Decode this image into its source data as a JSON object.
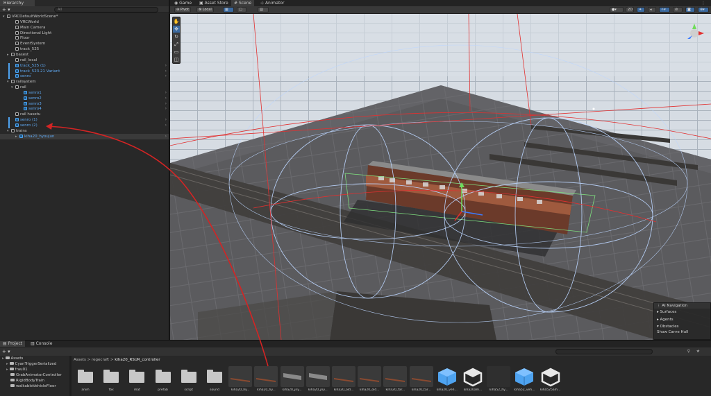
{
  "hierarchy": {
    "tab_label": "Hierarchy",
    "add_label": "+ ▾",
    "search_placeholder": "All",
    "rows": [
      {
        "label": "VRCDefaultWorldScene*",
        "indent": 0,
        "arrow": "▾",
        "blue": false,
        "chev": false
      },
      {
        "label": "VRCWorld",
        "indent": 2,
        "arrow": "",
        "blue": false,
        "chev": false
      },
      {
        "label": "Main Camera",
        "indent": 2,
        "arrow": "",
        "blue": false,
        "chev": false
      },
      {
        "label": "Directional Light",
        "indent": 2,
        "arrow": "",
        "blue": false,
        "chev": false
      },
      {
        "label": "Floor",
        "indent": 2,
        "arrow": "",
        "blue": false,
        "chev": false
      },
      {
        "label": "EventSystem",
        "indent": 2,
        "arrow": "",
        "blue": false,
        "chev": false
      },
      {
        "label": "track_525",
        "indent": 2,
        "arrow": "",
        "blue": false,
        "chev": false
      },
      {
        "label": "basest",
        "indent": 1,
        "arrow": "▸",
        "blue": false,
        "chev": false
      },
      {
        "label": "rail_local",
        "indent": 2,
        "arrow": "",
        "blue": false,
        "chev": false
      },
      {
        "label": "track_525 (1)",
        "indent": 2,
        "arrow": "",
        "blue": true,
        "chev": true
      },
      {
        "label": "track_523.21 Variant",
        "indent": 2,
        "arrow": "",
        "blue": true,
        "chev": true
      },
      {
        "label": "senro",
        "indent": 2,
        "arrow": "",
        "blue": true,
        "chev": true
      },
      {
        "label": "railsystem",
        "indent": 1,
        "arrow": "▾",
        "blue": false,
        "chev": false
      },
      {
        "label": "rail",
        "indent": 2,
        "arrow": "▾",
        "blue": false,
        "chev": false
      },
      {
        "label": "senro1",
        "indent": 4,
        "arrow": "",
        "blue": true,
        "chev": true
      },
      {
        "label": "senro2",
        "indent": 4,
        "arrow": "",
        "blue": true,
        "chev": true
      },
      {
        "label": "senro3",
        "indent": 4,
        "arrow": "",
        "blue": true,
        "chev": true
      },
      {
        "label": "senro4",
        "indent": 4,
        "arrow": "",
        "blue": true,
        "chev": true
      },
      {
        "label": "rail husetu",
        "indent": 2,
        "arrow": "",
        "blue": false,
        "chev": false
      },
      {
        "label": "senro (1)",
        "indent": 2,
        "arrow": "",
        "blue": true,
        "chev": true
      },
      {
        "label": "senro (2)",
        "indent": 2,
        "arrow": "",
        "blue": true,
        "chev": true
      },
      {
        "label": "trains",
        "indent": 1,
        "arrow": "▾",
        "blue": false,
        "chev": false
      },
      {
        "label": "kiha20_hyoujun",
        "indent": 3,
        "arrow": "▸",
        "blue": true,
        "chev": true
      }
    ]
  },
  "scene": {
    "tabs": [
      "Game",
      "Asset Store",
      "Scene",
      "Animator"
    ],
    "active_tab": "Scene",
    "pivot_label": "Pivot",
    "local_label": "Local",
    "mode_2d": "2D"
  },
  "nav_overlay": {
    "title": "AI Navigation",
    "items": [
      "Surfaces",
      "Agents",
      "Obstacles",
      "Show Carve Hull"
    ]
  },
  "project": {
    "tabs": [
      "Project",
      "Console"
    ],
    "add_label": "+ ▾",
    "tree": [
      {
        "label": "Assets",
        "level": 0
      },
      {
        "label": "CyanTriggerSerialized",
        "level": 1
      },
      {
        "label": "frau01",
        "level": 1
      },
      {
        "label": "GrabAnimatorController",
        "level": 2
      },
      {
        "label": "RigidBodyTrain",
        "level": 2
      },
      {
        "label": "walkableVehicleFloor",
        "level": 2
      }
    ],
    "breadcrumb": [
      "Assets",
      "regecraft",
      "kiha20_RSUR_controller"
    ],
    "assets": [
      {
        "label": "anim",
        "kind": "folder"
      },
      {
        "label": "fbx",
        "kind": "folder"
      },
      {
        "label": "mat",
        "kind": "folder"
      },
      {
        "label": "prefab",
        "kind": "folder"
      },
      {
        "label": "script",
        "kind": "folder"
      },
      {
        "label": "sound",
        "kind": "folder"
      },
      {
        "label": "kiha20_hy...",
        "kind": "train"
      },
      {
        "label": "kiha20_hy...",
        "kind": "train"
      },
      {
        "label": "kiha20_jny...",
        "kind": "doc"
      },
      {
        "label": "kiha20_jny...",
        "kind": "doc"
      },
      {
        "label": "kiha20_old...",
        "kind": "train"
      },
      {
        "label": "kiha20_old...",
        "kind": "train"
      },
      {
        "label": "kiha20_tar...",
        "kind": "train"
      },
      {
        "label": "kiha20_tar...",
        "kind": "train"
      },
      {
        "label": "kiha20_veh...",
        "kind": "cube-blue"
      },
      {
        "label": "kiha20am...",
        "kind": "unity"
      },
      {
        "label": "kiha52_hy...",
        "kind": "dark"
      },
      {
        "label": "kiha52_veh...",
        "kind": "cube-blue"
      },
      {
        "label": "kiha525am...",
        "kind": "unity"
      }
    ]
  },
  "colors": {
    "accent": "#3b6aa0",
    "blue_text": "#5fa8f1",
    "annotation_red": "#d42424"
  }
}
